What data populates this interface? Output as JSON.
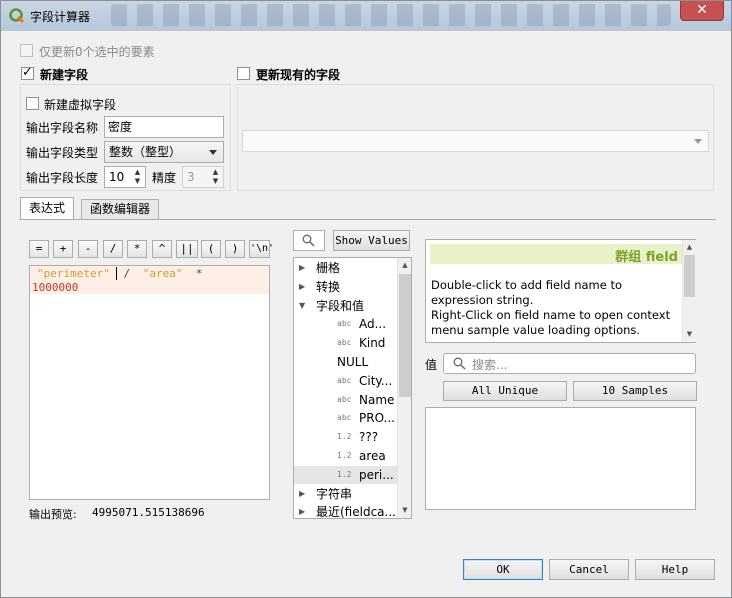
{
  "window": {
    "title": "字段计算器",
    "close": "✕"
  },
  "top": {
    "only_selected": "仅更新0个选中的要素",
    "new_field": "新建字段",
    "update_existing": "更新现有的字段",
    "virtual_field": "新建虚拟字段",
    "output_name_label": "输出字段名称",
    "output_name_value": "密度",
    "output_type_label": "输出字段类型",
    "output_type_value": "整数（整型）",
    "output_length_label": "输出字段长度",
    "output_length_value": "10",
    "precision_label": "精度",
    "precision_value": "3"
  },
  "tabs": [
    {
      "label": "表达式"
    },
    {
      "label": "函数编辑器"
    }
  ],
  "operators": [
    "=",
    "+",
    "-",
    "/",
    "*",
    "^",
    "||",
    "(",
    ")",
    "'\\n'"
  ],
  "expression": {
    "part1": "\"perimeter\"",
    "part2": " / ",
    "part3": "\"area\"",
    "part4": "  *",
    "line2": "1000000"
  },
  "preview": {
    "label": "输出预览:",
    "value": "4995071.515138696"
  },
  "function_search": {
    "show_values": "Show Values"
  },
  "tree": [
    {
      "expander": "▶",
      "name": "栅格"
    },
    {
      "expander": "▶",
      "name": "转换"
    },
    {
      "expander": "▼",
      "name": "字段和值"
    },
    {
      "type": "abc",
      "name": "Ad..."
    },
    {
      "type": "abc",
      "name": "Kind"
    },
    {
      "type": "",
      "name": "NULL"
    },
    {
      "type": "abc",
      "name": "City..."
    },
    {
      "type": "abc",
      "name": "Name"
    },
    {
      "type": "abc",
      "name": "PRO..."
    },
    {
      "type": "1.2",
      "name": "???"
    },
    {
      "type": "1.2",
      "name": "area"
    },
    {
      "type": "1.2",
      "name": "peri..."
    },
    {
      "expander": "▶",
      "name": "字符串"
    },
    {
      "expander": "▶",
      "name": "最近(fieldca..."
    }
  ],
  "help": {
    "title": "群组 field",
    "line1": "Double-click to add field name to expression string.",
    "line2": "Right-Click on field name to open context menu sample value loading options."
  },
  "values": {
    "label": "值",
    "search_placeholder": "搜索...",
    "all_unique": "All Unique",
    "ten_samples": "10 Samples"
  },
  "buttons": {
    "ok": "OK",
    "cancel": "Cancel",
    "help": "Help"
  },
  "colors": {
    "accent_title": "#7ba32a",
    "string_literal": "#c8a030",
    "number_literal": "#c0392b"
  }
}
